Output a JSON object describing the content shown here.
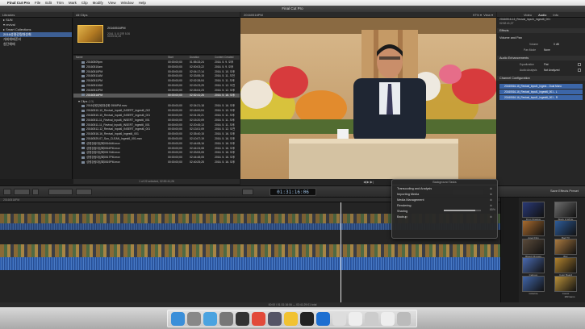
{
  "menubar": {
    "apple": "",
    "app": "Final Cut Pro",
    "items": [
      "File",
      "Edit",
      "Trim",
      "Mark",
      "Clip",
      "Modify",
      "View",
      "Window",
      "Help"
    ]
  },
  "titlebar": {
    "title": "Final Cut Pro"
  },
  "library": {
    "header": "Libraries",
    "items": [
      {
        "label": "▸ SUN"
      },
      {
        "label": "▾ revival"
      },
      {
        "label": "  ▸ Smart Collections"
      },
      {
        "label": "  2016성령강림대성회"
      },
      {
        "label": "  개회예배준비"
      },
      {
        "label": "  첨단예배"
      }
    ],
    "selected_index": 3
  },
  "browser": {
    "header": "All Clips",
    "preview": {
      "title": "20160516PM",
      "meta1": "2016. 5. 8 오후 5:26",
      "meta2": "00:05:51;28"
    },
    "columns": [
      "Name",
      "Start",
      "Duration",
      "Content Created"
    ],
    "rows": [
      {
        "name": "20160509pm",
        "start": "00:00:00;00",
        "dur": "01:55:33;24",
        "created": "2016. 5. 9. 오후"
      },
      {
        "name": "20160510am",
        "start": "00:00:00;00",
        "dur": "02:00:03;22",
        "created": "2016. 5. 9. 오후"
      },
      {
        "name": "20160510PM",
        "start": "00:00:00;00",
        "dur": "02:04:17;14",
        "created": "2016. 5. 10. 오후"
      },
      {
        "name": "20160511AM",
        "start": "00:00:00;00",
        "dur": "02:33:55;15",
        "created": "2016. 5. 11. 오전"
      },
      {
        "name": "20160511PM",
        "start": "00:00:00;00",
        "dur": "02:02:28;04",
        "created": "2016. 5. 11. 오후"
      },
      {
        "name": "20160512AM",
        "start": "00:00:00;00",
        "dur": "02:03:23;29",
        "created": "2016. 5. 12. 오전"
      },
      {
        "name": "20160512PM",
        "start": "00:00:00;00",
        "dur": "02:26:04;23",
        "created": "2016. 5. 12. 오후"
      },
      {
        "name": "20160516PM",
        "start": "00:00:00;00",
        "dur": "02:52:41;26",
        "created": "2016. 5. 16. 오후"
      }
    ],
    "clips_label": "Clips",
    "clips_count": "(13)",
    "clip_rows": [
      {
        "name": "2016성령강림대성회 0506PM.mov",
        "start": "00:00:00;00",
        "dur": "02:34:21;18",
        "created": "2016. 5. 16. 오후"
      },
      {
        "name": "20160510-10_Revival_Input6_INSERT_Ingest6_002",
        "start": "00:00:00;00",
        "dur": "02:18:00;04",
        "created": "2016. 5. 10. 오후"
      },
      {
        "name": "20160510-10_Revival_Input6_INSERT_Ingest6_001",
        "start": "00:00:00;00",
        "dur": "02:01:26;21",
        "created": "2016. 5. 11. 오후"
      },
      {
        "name": "20160511-11_Revival_Input6_INSERT_Ingest6_001",
        "start": "00:00:00;00",
        "dur": "02:15:20;09",
        "created": "2016. 5. 11. 오후"
      },
      {
        "name": "20160511-11_Revival_Input6_INSERT_Ingest6_001",
        "start": "00:00:00;00",
        "dur": "02:20:45;13",
        "created": "2016. 5. 11. 오후"
      },
      {
        "name": "20160512-12_Revival_Input6_INSERT_Ingest6_001",
        "start": "00:00:00;00",
        "dur": "02:13:01;09",
        "created": "2016. 5. 12. 오전"
      },
      {
        "name": "20160516-16_Revival_Input6_Ingest6_001",
        "start": "00:00:00;00",
        "dur": "02:35:40;15",
        "created": "2016. 5. 16. 오후"
      },
      {
        "name": "20160529-07_Sun_CLEAN_Ingest6_001.mov",
        "start": "00:00:00;00",
        "dur": "02:10:07;19",
        "created": "2016. 5. 16. 오후"
      },
      {
        "name": "성령강림대성회0516AM.mov",
        "start": "00:00:00;00",
        "dur": "02:44:08;16",
        "created": "2016. 5. 16. 오후"
      },
      {
        "name": "성령강림대성회0516PM.mov",
        "start": "00:00:00;00",
        "dur": "02:44:24;08",
        "created": "2016. 5. 16. 오후"
      },
      {
        "name": "성령강림대성회0517AM.mov",
        "start": "00:00:00;00",
        "dur": "02:33:53;05",
        "created": "2016. 5. 16. 오후"
      },
      {
        "name": "성령강림대성회0517PM.mov",
        "start": "00:00:00;00",
        "dur": "02:44:48;05",
        "created": "2016. 5. 16. 오후"
      },
      {
        "name": "성령강림대성회0519PM.mov",
        "start": "00:00:00;00",
        "dur": "02:40:25;25",
        "created": "2016. 5. 16. 오후"
      }
    ],
    "footer": "1 of 22 selected, 02:52:41;26"
  },
  "viewer": {
    "title": "20160516PM",
    "zoom": "97%",
    "view": "View"
  },
  "inspector": {
    "tabs": [
      "Video",
      "Audio",
      "Info"
    ],
    "clip_name": "20160516-16_Revival_Input1_Ingest6_001",
    "clip_dur": "02:52:41;27",
    "effects": "Effects",
    "volume_pan": "Volume and Pan",
    "volume_label": "Volume",
    "volume_value": "0 dB",
    "pan_label": "Pan Mode",
    "pan_value": "None",
    "enh": "Audio Enhancements",
    "eq_label": "Equalization",
    "eq_value": "Flat",
    "analysis_label": "Audio Analysis",
    "analysis_value": "Not Analyzed",
    "chan": "Channel Configuration",
    "channels": [
      "20160516-16_Revival_Input1_Ingest... Dual Mono",
      "20160516-16_Revival_Input1_Ingest6_001 - L",
      "20160516-16_Revival_Input1_Ingest6_001 - R"
    ]
  },
  "toolbar": {
    "timecode": "01:31:16:06",
    "save_preset": "Save Effects Preset"
  },
  "timeline": {
    "header": "20160516PM"
  },
  "bg_tasks": {
    "title": "Background Tasks",
    "items": [
      "Transcoding and Analysis",
      "Importing Media",
      "Media Management",
      "Rendering",
      "Sharing",
      "Backup"
    ],
    "sharing_progress": 0.85,
    "sharing_pct": "85%"
  },
  "effects": {
    "tiles": [
      {
        "label": "Drop Shadow",
        "color": "#2a3a78"
      },
      {
        "label": "Black & White",
        "color": "#6d6d6d"
      },
      {
        "label": "Aged Film",
        "color": "#a86b2e"
      },
      {
        "label": "Bad TV",
        "color": "#2e5c99"
      },
      {
        "label": "Bleach Bypass",
        "color": "#5a4a3a"
      },
      {
        "label": "Blur",
        "color": "#aa7a40"
      },
      {
        "label": "Cartoon",
        "color": "#4a6ab0"
      },
      {
        "label": "Color Board",
        "color": "#b0822e"
      },
      {
        "label": "Colorize",
        "color": "#4166a8"
      },
      {
        "label": "Comic",
        "color": "#b8903a"
      }
    ],
    "count": "183 items"
  },
  "status": "00:00 / 01:31:16:06 — 03:41:29:01 total",
  "dock": {
    "icons": [
      "finder-icon",
      "launchpad-icon",
      "safari-icon",
      "system-prefs-icon",
      "final-cut-icon",
      "chrome-icon",
      "compressor-icon",
      "cyberduck-icon",
      "activity-monitor-icon",
      "teamviewer-icon",
      "preview-icon",
      "document-icon",
      "folder-icon",
      "image-icon",
      "trash-icon"
    ]
  }
}
